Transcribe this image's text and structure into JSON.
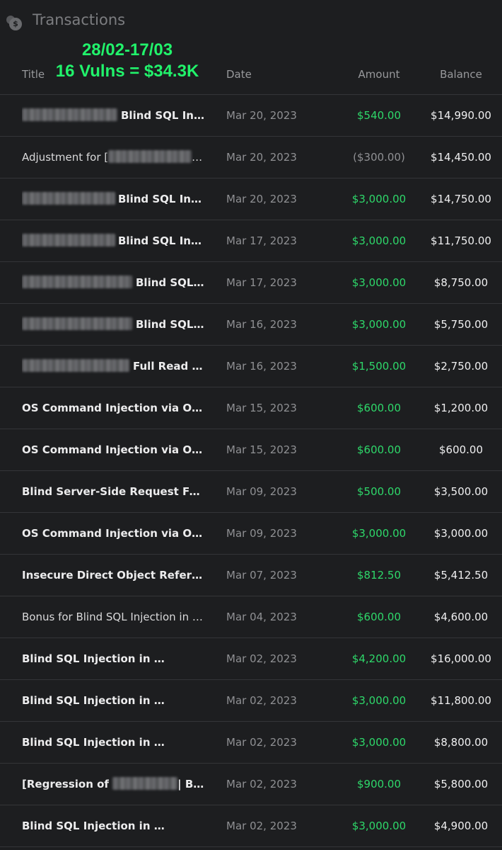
{
  "header": {
    "title": "Transactions",
    "icon": "coins-icon"
  },
  "overlay": {
    "line1": "28/02-17/03",
    "line2": "16 Vulns = $34.3K",
    "color": "#21f36b"
  },
  "columns": {
    "title": "Title",
    "date": "Date",
    "amount": "Amount",
    "balance": "Balance"
  },
  "colors": {
    "positive": "#2ed86a",
    "negative": "#8f9093",
    "background": "#1d1e20"
  },
  "rows": [
    {
      "prefix": "",
      "suffix": "Blind SQL Inj…",
      "date": "Mar 20, 2023",
      "amount": "$540.00",
      "balance": "$14,990.00"
    },
    {
      "prefix": "Adjustment for [",
      "suffix": "] …",
      "date": "Mar 20, 2023",
      "amount": "($300.00)",
      "balance": "$14,450.00"
    },
    {
      "prefix": "",
      "suffix": "Blind SQL Inje…",
      "date": "Mar 20, 2023",
      "amount": "$3,000.00",
      "balance": "$14,750.00"
    },
    {
      "prefix": "",
      "suffix": "Blind SQL Inje…",
      "date": "Mar 17, 2023",
      "amount": "$3,000.00",
      "balance": "$11,750.00"
    },
    {
      "prefix": "",
      "suffix": "Blind SQL …",
      "date": "Mar 17, 2023",
      "amount": "$3,000.00",
      "balance": "$8,750.00"
    },
    {
      "prefix": "",
      "suffix": "Blind SQL …",
      "date": "Mar 16, 2023",
      "amount": "$3,000.00",
      "balance": "$5,750.00"
    },
    {
      "prefix": "",
      "suffix": "Full Read S…",
      "date": "Mar 16, 2023",
      "amount": "$1,500.00",
      "balance": "$2,750.00"
    },
    {
      "prefix": "OS Command Injection via Origin…",
      "suffix": "",
      "date": "Mar 15, 2023",
      "amount": "$600.00",
      "balance": "$1,200.00"
    },
    {
      "prefix": "OS Command Injection via Origin…",
      "suffix": "",
      "date": "Mar 15, 2023",
      "amount": "$600.00",
      "balance": "$600.00"
    },
    {
      "prefix": "Blind Server-Side Request Forger…",
      "suffix": "",
      "date": "Mar 09, 2023",
      "amount": "$500.00",
      "balance": "$3,500.00"
    },
    {
      "prefix": "OS Command Injection via Origin…",
      "suffix": "",
      "date": "Mar 09, 2023",
      "amount": "$3,000.00",
      "balance": "$3,000.00"
    },
    {
      "prefix": "Insecure Direct Object Reference …",
      "suffix": "",
      "date": "Mar 07, 2023",
      "amount": "$812.50",
      "balance": "$5,412.50"
    },
    {
      "prefix": "Bonus for Blind SQL Injection in th…",
      "suffix": "",
      "date": "Mar 04, 2023",
      "amount": "$600.00",
      "balance": "$4,600.00"
    },
    {
      "prefix": "Blind SQL Injection in ",
      "suffix": "",
      "date": "Mar 02, 2023",
      "amount": "$4,200.00",
      "balance": "$16,000.00"
    },
    {
      "prefix": "Blind SQL Injection in ",
      "suffix": "",
      "date": "Mar 02, 2023",
      "amount": "$3,000.00",
      "balance": "$11,800.00"
    },
    {
      "prefix": "Blind SQL Injection in ",
      "suffix": "",
      "date": "Mar 02, 2023",
      "amount": "$3,000.00",
      "balance": "$8,800.00"
    },
    {
      "prefix": "[Regression of ",
      "suffix": "| Blind…",
      "date": "Mar 02, 2023",
      "amount": "$900.00",
      "balance": "$5,800.00"
    },
    {
      "prefix": "Blind SQL Injection in ",
      "suffix": "",
      "date": "Mar 02, 2023",
      "amount": "$3,000.00",
      "balance": "$4,900.00"
    }
  ]
}
